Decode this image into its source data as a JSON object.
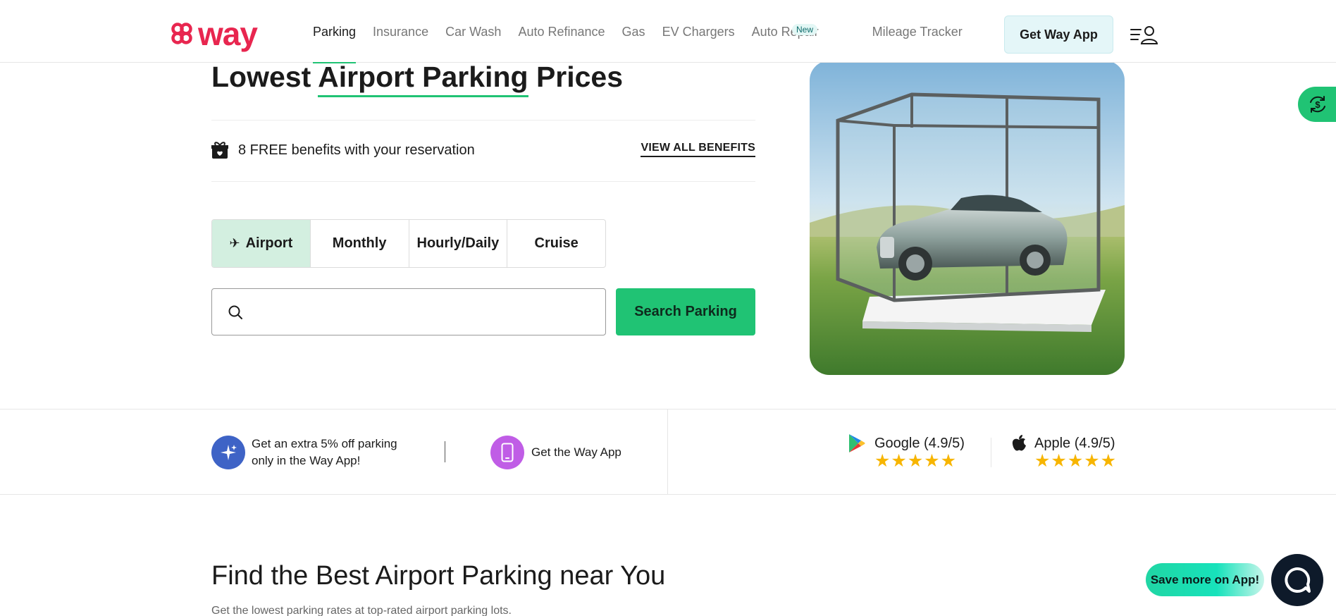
{
  "header": {
    "logo_text": "way",
    "nav": [
      {
        "label": "Parking",
        "active": true
      },
      {
        "label": "Insurance"
      },
      {
        "label": "Car Wash"
      },
      {
        "label": "Auto Refinance"
      },
      {
        "label": "Gas"
      },
      {
        "label": "EV Chargers"
      },
      {
        "label": "Auto Repair"
      },
      {
        "label": "Mileage Tracker"
      }
    ],
    "new_badge": "New",
    "get_app_label": "Get Way App"
  },
  "hero": {
    "title_prefix": "Lowest ",
    "title_highlight": "Airport Parking",
    "title_suffix": " Prices",
    "benefits_text": "8 FREE benefits with your reservation",
    "view_all_label": "VIEW ALL BENEFITS",
    "tabs": [
      "Airport",
      "Monthly",
      "Hourly/Daily",
      "Cruise"
    ],
    "active_tab": "Airport",
    "search_placeholder": "",
    "search_button": "Search Parking"
  },
  "strip": {
    "promo_extra": "Get an extra 5% off parking only in the Way App!",
    "promo_app": "Get the Way App",
    "ratings": [
      {
        "name": "Google (4.9/5)",
        "stars": 5
      },
      {
        "name": "Apple (4.9/5)",
        "stars": 5
      }
    ]
  },
  "section": {
    "title": "Find the Best Airport Parking near You",
    "subtitle": "Get the lowest parking rates at top-rated airport parking lots."
  },
  "widgets": {
    "save_more": "Save more on App!"
  },
  "colors": {
    "brand": "#e8264f",
    "accent": "#20c374",
    "star": "#f7b500"
  }
}
